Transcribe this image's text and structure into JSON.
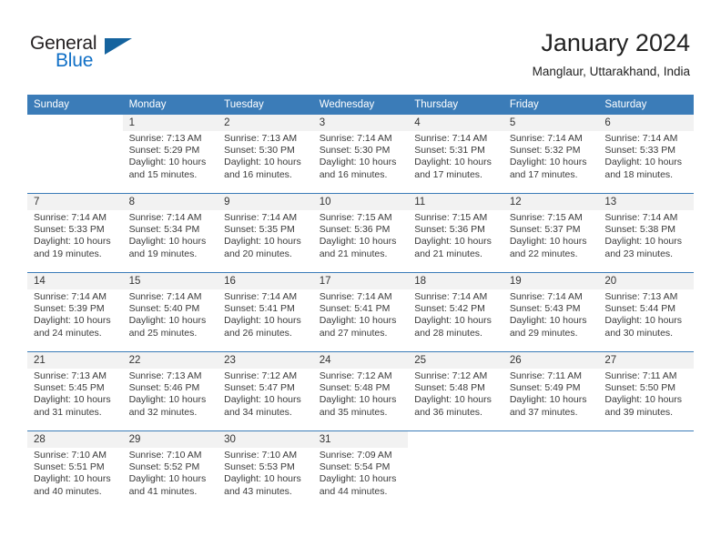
{
  "brand": {
    "name_top": "General",
    "name_bottom": "Blue",
    "triangle_color": "#15639e",
    "blue_color": "#0f6fc6"
  },
  "header": {
    "title": "January 2024",
    "subtitle": "Manglaur, Uttarakhand, India"
  },
  "theme": {
    "header_bg": "#3b7cb8",
    "daterow_bg": "#f2f2f2",
    "cell_bg": "#ffffff",
    "text": "#333333"
  },
  "weekdays": [
    "Sunday",
    "Monday",
    "Tuesday",
    "Wednesday",
    "Thursday",
    "Friday",
    "Saturday"
  ],
  "weeks": [
    [
      {
        "day": "",
        "sunrise": "",
        "sunset": "",
        "daylight1": "",
        "daylight2": ""
      },
      {
        "day": "1",
        "sunrise": "Sunrise: 7:13 AM",
        "sunset": "Sunset: 5:29 PM",
        "daylight1": "Daylight: 10 hours",
        "daylight2": "and 15 minutes."
      },
      {
        "day": "2",
        "sunrise": "Sunrise: 7:13 AM",
        "sunset": "Sunset: 5:30 PM",
        "daylight1": "Daylight: 10 hours",
        "daylight2": "and 16 minutes."
      },
      {
        "day": "3",
        "sunrise": "Sunrise: 7:14 AM",
        "sunset": "Sunset: 5:30 PM",
        "daylight1": "Daylight: 10 hours",
        "daylight2": "and 16 minutes."
      },
      {
        "day": "4",
        "sunrise": "Sunrise: 7:14 AM",
        "sunset": "Sunset: 5:31 PM",
        "daylight1": "Daylight: 10 hours",
        "daylight2": "and 17 minutes."
      },
      {
        "day": "5",
        "sunrise": "Sunrise: 7:14 AM",
        "sunset": "Sunset: 5:32 PM",
        "daylight1": "Daylight: 10 hours",
        "daylight2": "and 17 minutes."
      },
      {
        "day": "6",
        "sunrise": "Sunrise: 7:14 AM",
        "sunset": "Sunset: 5:33 PM",
        "daylight1": "Daylight: 10 hours",
        "daylight2": "and 18 minutes."
      }
    ],
    [
      {
        "day": "7",
        "sunrise": "Sunrise: 7:14 AM",
        "sunset": "Sunset: 5:33 PM",
        "daylight1": "Daylight: 10 hours",
        "daylight2": "and 19 minutes."
      },
      {
        "day": "8",
        "sunrise": "Sunrise: 7:14 AM",
        "sunset": "Sunset: 5:34 PM",
        "daylight1": "Daylight: 10 hours",
        "daylight2": "and 19 minutes."
      },
      {
        "day": "9",
        "sunrise": "Sunrise: 7:14 AM",
        "sunset": "Sunset: 5:35 PM",
        "daylight1": "Daylight: 10 hours",
        "daylight2": "and 20 minutes."
      },
      {
        "day": "10",
        "sunrise": "Sunrise: 7:15 AM",
        "sunset": "Sunset: 5:36 PM",
        "daylight1": "Daylight: 10 hours",
        "daylight2": "and 21 minutes."
      },
      {
        "day": "11",
        "sunrise": "Sunrise: 7:15 AM",
        "sunset": "Sunset: 5:36 PM",
        "daylight1": "Daylight: 10 hours",
        "daylight2": "and 21 minutes."
      },
      {
        "day": "12",
        "sunrise": "Sunrise: 7:15 AM",
        "sunset": "Sunset: 5:37 PM",
        "daylight1": "Daylight: 10 hours",
        "daylight2": "and 22 minutes."
      },
      {
        "day": "13",
        "sunrise": "Sunrise: 7:14 AM",
        "sunset": "Sunset: 5:38 PM",
        "daylight1": "Daylight: 10 hours",
        "daylight2": "and 23 minutes."
      }
    ],
    [
      {
        "day": "14",
        "sunrise": "Sunrise: 7:14 AM",
        "sunset": "Sunset: 5:39 PM",
        "daylight1": "Daylight: 10 hours",
        "daylight2": "and 24 minutes."
      },
      {
        "day": "15",
        "sunrise": "Sunrise: 7:14 AM",
        "sunset": "Sunset: 5:40 PM",
        "daylight1": "Daylight: 10 hours",
        "daylight2": "and 25 minutes."
      },
      {
        "day": "16",
        "sunrise": "Sunrise: 7:14 AM",
        "sunset": "Sunset: 5:41 PM",
        "daylight1": "Daylight: 10 hours",
        "daylight2": "and 26 minutes."
      },
      {
        "day": "17",
        "sunrise": "Sunrise: 7:14 AM",
        "sunset": "Sunset: 5:41 PM",
        "daylight1": "Daylight: 10 hours",
        "daylight2": "and 27 minutes."
      },
      {
        "day": "18",
        "sunrise": "Sunrise: 7:14 AM",
        "sunset": "Sunset: 5:42 PM",
        "daylight1": "Daylight: 10 hours",
        "daylight2": "and 28 minutes."
      },
      {
        "day": "19",
        "sunrise": "Sunrise: 7:14 AM",
        "sunset": "Sunset: 5:43 PM",
        "daylight1": "Daylight: 10 hours",
        "daylight2": "and 29 minutes."
      },
      {
        "day": "20",
        "sunrise": "Sunrise: 7:13 AM",
        "sunset": "Sunset: 5:44 PM",
        "daylight1": "Daylight: 10 hours",
        "daylight2": "and 30 minutes."
      }
    ],
    [
      {
        "day": "21",
        "sunrise": "Sunrise: 7:13 AM",
        "sunset": "Sunset: 5:45 PM",
        "daylight1": "Daylight: 10 hours",
        "daylight2": "and 31 minutes."
      },
      {
        "day": "22",
        "sunrise": "Sunrise: 7:13 AM",
        "sunset": "Sunset: 5:46 PM",
        "daylight1": "Daylight: 10 hours",
        "daylight2": "and 32 minutes."
      },
      {
        "day": "23",
        "sunrise": "Sunrise: 7:12 AM",
        "sunset": "Sunset: 5:47 PM",
        "daylight1": "Daylight: 10 hours",
        "daylight2": "and 34 minutes."
      },
      {
        "day": "24",
        "sunrise": "Sunrise: 7:12 AM",
        "sunset": "Sunset: 5:48 PM",
        "daylight1": "Daylight: 10 hours",
        "daylight2": "and 35 minutes."
      },
      {
        "day": "25",
        "sunrise": "Sunrise: 7:12 AM",
        "sunset": "Sunset: 5:48 PM",
        "daylight1": "Daylight: 10 hours",
        "daylight2": "and 36 minutes."
      },
      {
        "day": "26",
        "sunrise": "Sunrise: 7:11 AM",
        "sunset": "Sunset: 5:49 PM",
        "daylight1": "Daylight: 10 hours",
        "daylight2": "and 37 minutes."
      },
      {
        "day": "27",
        "sunrise": "Sunrise: 7:11 AM",
        "sunset": "Sunset: 5:50 PM",
        "daylight1": "Daylight: 10 hours",
        "daylight2": "and 39 minutes."
      }
    ],
    [
      {
        "day": "28",
        "sunrise": "Sunrise: 7:10 AM",
        "sunset": "Sunset: 5:51 PM",
        "daylight1": "Daylight: 10 hours",
        "daylight2": "and 40 minutes."
      },
      {
        "day": "29",
        "sunrise": "Sunrise: 7:10 AM",
        "sunset": "Sunset: 5:52 PM",
        "daylight1": "Daylight: 10 hours",
        "daylight2": "and 41 minutes."
      },
      {
        "day": "30",
        "sunrise": "Sunrise: 7:10 AM",
        "sunset": "Sunset: 5:53 PM",
        "daylight1": "Daylight: 10 hours",
        "daylight2": "and 43 minutes."
      },
      {
        "day": "31",
        "sunrise": "Sunrise: 7:09 AM",
        "sunset": "Sunset: 5:54 PM",
        "daylight1": "Daylight: 10 hours",
        "daylight2": "and 44 minutes."
      },
      {
        "day": "",
        "sunrise": "",
        "sunset": "",
        "daylight1": "",
        "daylight2": ""
      },
      {
        "day": "",
        "sunrise": "",
        "sunset": "",
        "daylight1": "",
        "daylight2": ""
      },
      {
        "day": "",
        "sunrise": "",
        "sunset": "",
        "daylight1": "",
        "daylight2": ""
      }
    ]
  ]
}
